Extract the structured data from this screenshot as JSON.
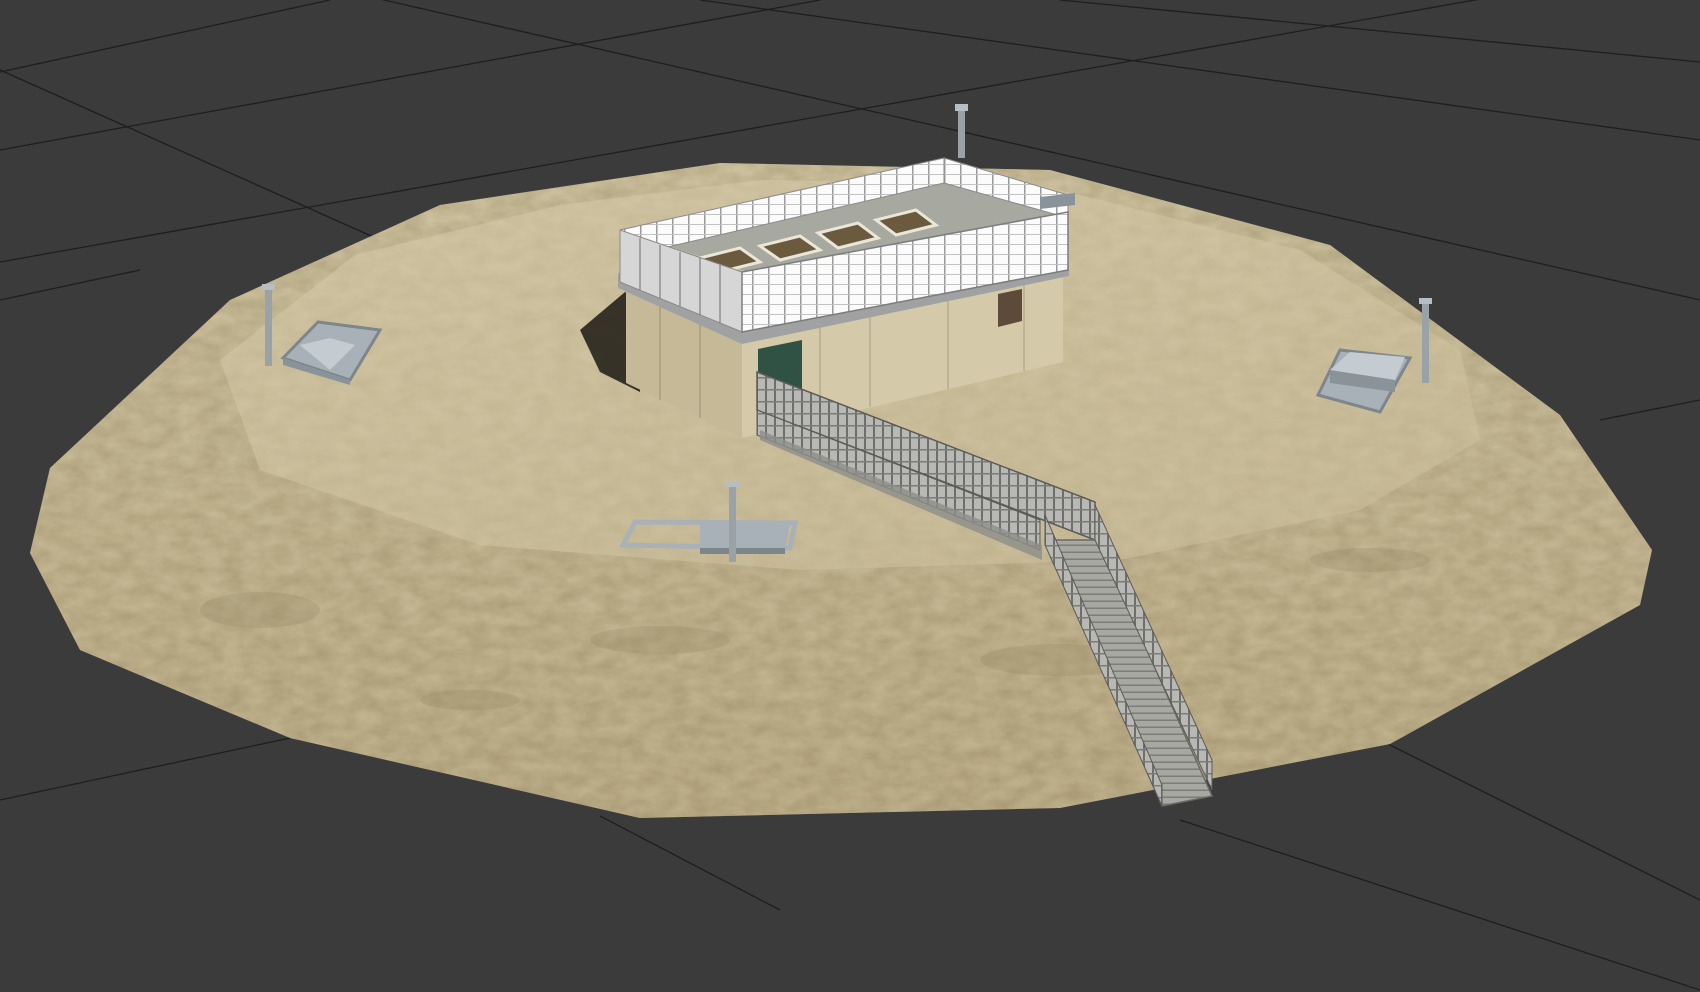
{
  "viewport": {
    "background": "#3b3b3b",
    "grid_color": "#1e1e1e",
    "shading": "realistic"
  },
  "scene": {
    "terrain": {
      "shape": "octagonal-mound",
      "material": "sand",
      "color": "#c9bd9a"
    },
    "building": {
      "wall_color": "#cfc4a4",
      "door_color": "#2f5244",
      "roof_railing": "white-slatted"
    },
    "walkway": {
      "type": "fenced-ramp",
      "fence_color": "#9a9a96"
    },
    "fixtures": [
      {
        "type": "hatch-with-vent-pipe",
        "color": "#a9b1b8"
      },
      {
        "type": "hatch-with-vent-pipe",
        "color": "#a9b1b8"
      },
      {
        "type": "hatch-with-vent-pipe",
        "color": "#a9b1b8"
      },
      {
        "type": "vent-pipe",
        "color": "#a9b1b8"
      }
    ]
  }
}
